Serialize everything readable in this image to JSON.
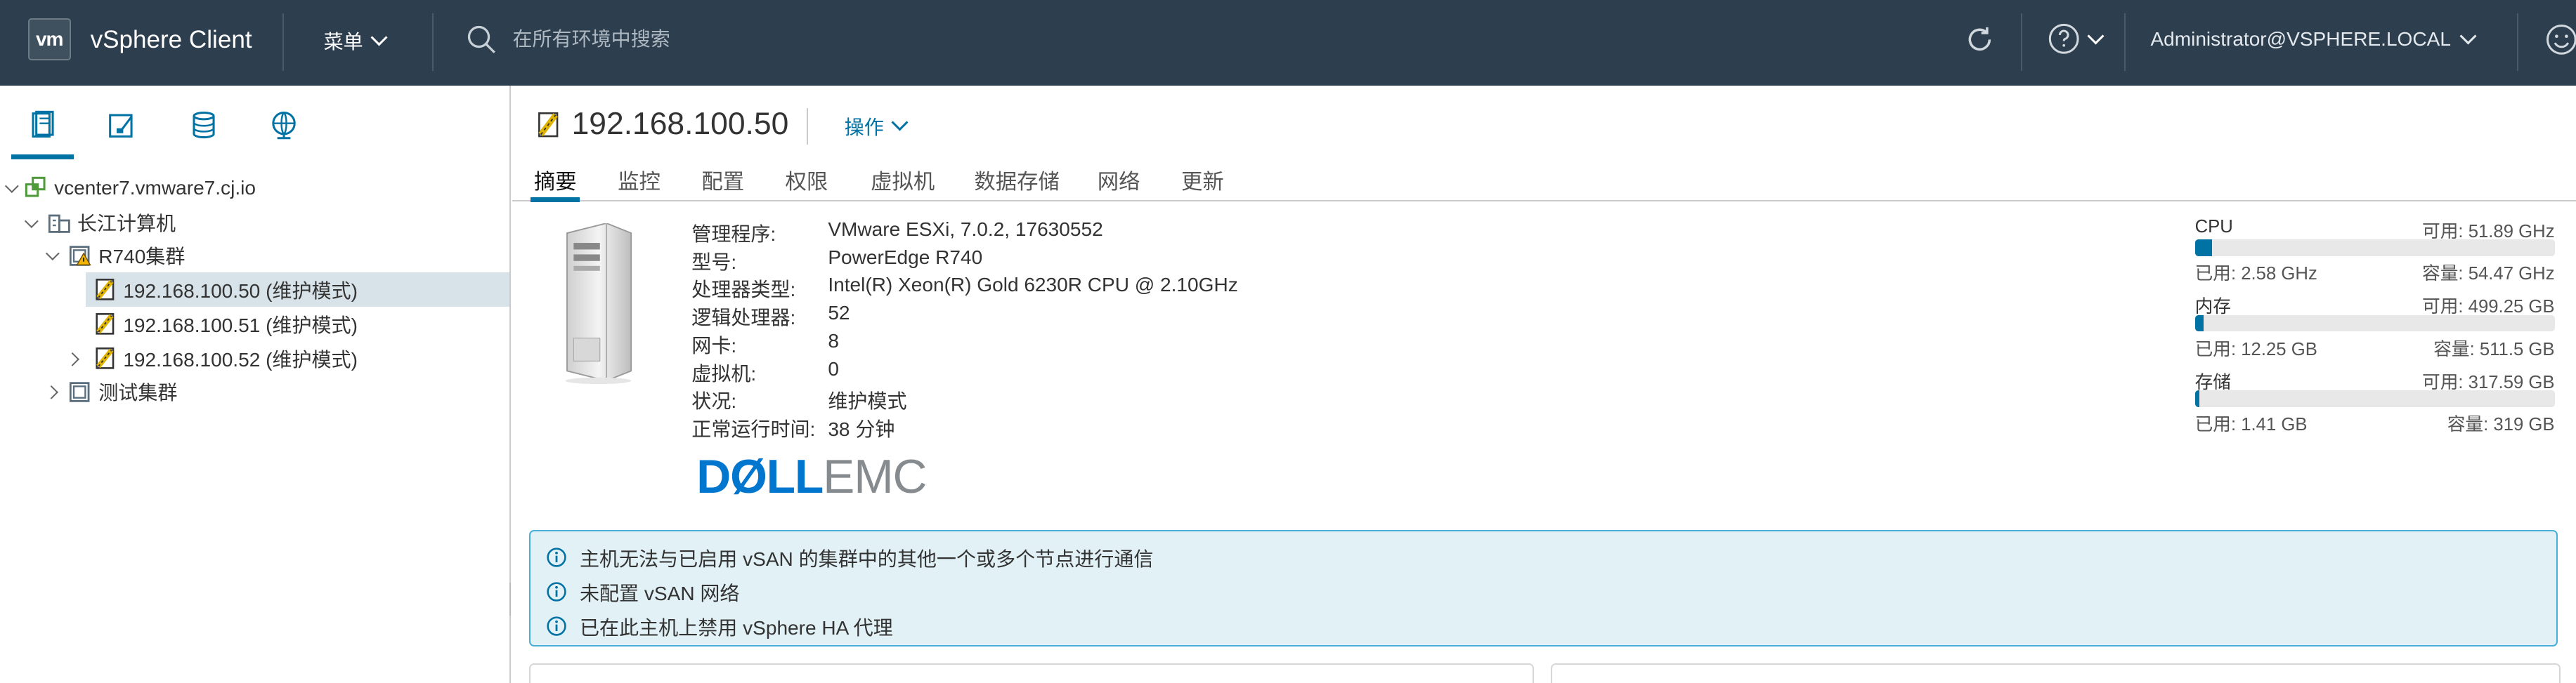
{
  "header": {
    "logo": "vm",
    "app_title": "vSphere Client",
    "menu_label": "菜单",
    "search_placeholder": "在所有环境中搜索",
    "user": "Administrator@VSPHERE.LOCAL",
    "icons": [
      "refresh-icon",
      "help-icon",
      "smiley-icon"
    ]
  },
  "nav": {
    "tabs": [
      "hosts-clusters-icon",
      "vms-templates-icon",
      "storage-icon",
      "network-icon"
    ],
    "tree": [
      {
        "label": "vcenter7.vmware7.cj.io",
        "type": "vcenter",
        "expanded": true
      },
      {
        "label": "长江计算机",
        "type": "datacenter",
        "expanded": true
      },
      {
        "label": "R740集群",
        "type": "cluster-warning",
        "expanded": true
      },
      {
        "label": "192.168.100.50 (维护模式)",
        "type": "host-maintenance",
        "selected": true
      },
      {
        "label": "192.168.100.51 (维护模式)",
        "type": "host-maintenance"
      },
      {
        "label": "192.168.100.52 (维护模式)",
        "type": "host-maintenance",
        "expanded": false
      },
      {
        "label": "测试集群",
        "type": "cluster",
        "expanded": false
      }
    ]
  },
  "main": {
    "title": "192.168.100.50",
    "actions_label": "操作",
    "tabs": [
      "摘要",
      "监控",
      "配置",
      "权限",
      "虚拟机",
      "数据存储",
      "网络",
      "更新"
    ],
    "active_tab": "摘要",
    "properties": [
      {
        "label": "管理程序:",
        "value": "VMware ESXi, 7.0.2, 17630552"
      },
      {
        "label": "型号:",
        "value": "PowerEdge R740"
      },
      {
        "label": "处理器类型:",
        "value": "Intel(R) Xeon(R) Gold 6230R CPU @ 2.10GHz"
      },
      {
        "label": "逻辑处理器:",
        "value": "52"
      },
      {
        "label": "网卡:",
        "value": "8"
      },
      {
        "label": "虚拟机:",
        "value": "0"
      },
      {
        "label": "状况:",
        "value": "维护模式"
      },
      {
        "label": "正常运行时间:",
        "value": "38 分钟"
      }
    ],
    "vendor_logo": {
      "left": "DØLL",
      "right": "EMC"
    },
    "resources": [
      {
        "name": "CPU",
        "available": "可用: 51.89 GHz",
        "used": "已用: 2.58 GHz",
        "capacity": "容量: 54.47 GHz",
        "used_fraction": 0.047
      },
      {
        "name": "内存",
        "available": "可用: 499.25 GB",
        "used": "已用: 12.25 GB",
        "capacity": "容量: 511.5 GB",
        "used_fraction": 0.024
      },
      {
        "name": "存储",
        "available": "可用: 317.59 GB",
        "used": "已用: 1.41 GB",
        "capacity": "容量: 319 GB",
        "used_fraction": 0.004
      }
    ],
    "alerts": [
      "主机无法与已启用 vSAN 的集群中的其他一个或多个节点进行通信",
      "未配置 vSAN 网络",
      "已在此主机上禁用 vSphere HA 代理"
    ]
  },
  "colors": {
    "header_bg": "#2d3e4f",
    "accent": "#0072a3",
    "alert_bg": "#e1f1f6",
    "alert_border": "#49afd9"
  }
}
